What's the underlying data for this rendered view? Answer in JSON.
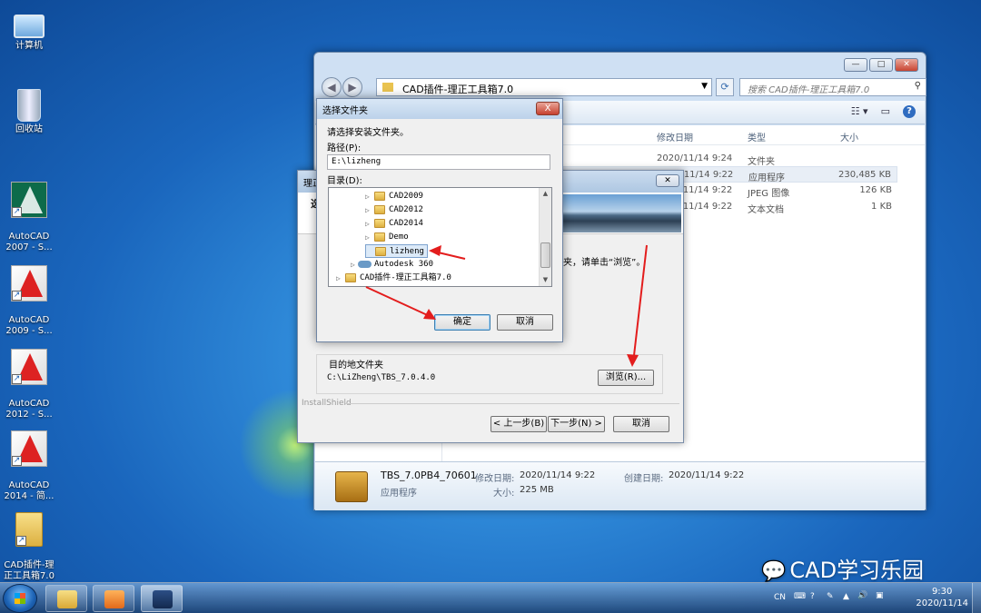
{
  "desktop": {
    "icons": [
      {
        "label": "计算机"
      },
      {
        "label": "回收站"
      },
      {
        "label": "AutoCAD\n2007 - S..."
      },
      {
        "label": "AutoCAD\n2009 - S..."
      },
      {
        "label": "AutoCAD\n2012 - S..."
      },
      {
        "label": "AutoCAD\n2014 - 简..."
      },
      {
        "label": "CAD插件-理\n正工具箱7.0"
      }
    ]
  },
  "explorer": {
    "address": "CAD插件-理正工具箱7.0",
    "search_placeholder": "搜索 CAD插件-理正工具箱7.0",
    "columns": [
      "修改日期",
      "类型",
      "大小"
    ],
    "rows": [
      {
        "date": "2020/11/14 9:24",
        "type": "文件夹",
        "size": ""
      },
      {
        "date": "2020/11/14 9:22",
        "type": "应用程序",
        "size": "230,485 KB"
      },
      {
        "date": "2020/11/14 9:22",
        "type": "JPEG 图像",
        "size": "126 KB"
      },
      {
        "date": "2020/11/14 9:22",
        "type": "文本文档",
        "size": "1 KB"
      }
    ],
    "details": {
      "filename": "TBS_7.0PB4_70601",
      "modified_label": "修改日期:",
      "modified": "2020/11/14 9:22",
      "created_label": "创建日期:",
      "created": "2020/11/14 9:22",
      "kind": "应用程序",
      "size_label": "大小:",
      "size": "225 MB"
    }
  },
  "installer": {
    "title": "理正",
    "subtitle": "选",
    "instruction": "夹，请单击“浏览”。",
    "dest_group": "目的地文件夹",
    "dest_path": "C:\\LiZheng\\TBS_7.0.4.0",
    "browse": "浏览(R)...",
    "brand": "InstallShield",
    "back": "< 上一步(B)",
    "next": "下一步(N) >",
    "cancel": "取消"
  },
  "folder_dialog": {
    "title": "选择文件夹",
    "prompt": "请选择安装文件夹。",
    "path_label": "路径(P):",
    "path_value": "E:\\lizheng",
    "dir_label": "目录(D):",
    "tree": [
      "CAD2009",
      "CAD2012",
      "CAD2014",
      "Demo",
      "lizheng",
      "Autodesk 360",
      "CAD插件-理正工具箱7.0"
    ],
    "ok": "确定",
    "cancel": "取消",
    "close": "X"
  },
  "taskbar": {
    "lang": "CN",
    "time": "9:30",
    "date": "2020/11/14"
  },
  "watermark": "CAD学习乐园",
  "colors": {
    "accent_arrow": "#e31d1d",
    "selection": "#dceaf8"
  }
}
